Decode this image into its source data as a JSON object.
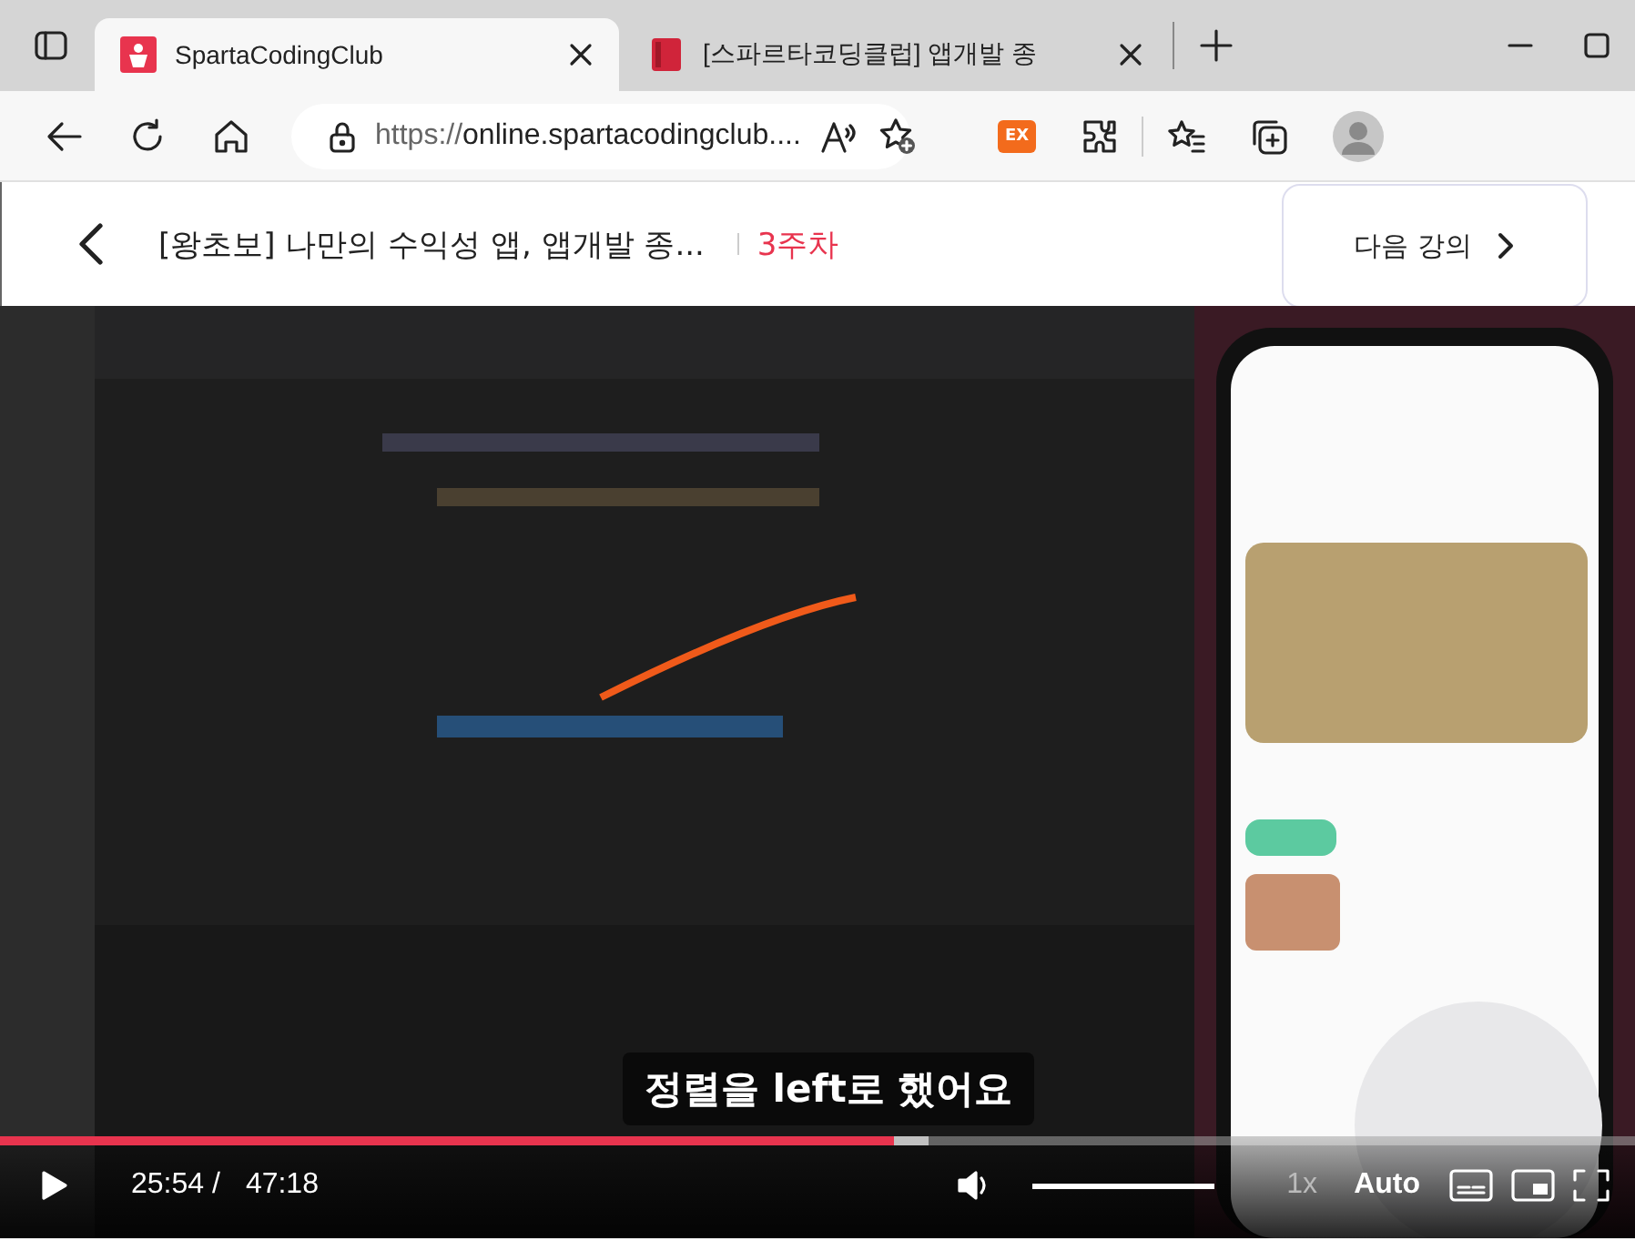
{
  "browser": {
    "tabs": [
      {
        "title": "SpartaCodingClub",
        "selected": true
      },
      {
        "title": "[스파르타코딩클럽] 앱개발 종",
        "selected": false
      }
    ],
    "url": {
      "prefix": "https://",
      "host": "online.spartacodingclub...."
    },
    "extension_badge": "EX"
  },
  "lecture_header": {
    "title": "[왕초보] 나만의 수익성 앱, 앱개발 종...",
    "week": "3주차",
    "next_button": "다음 강의"
  },
  "video": {
    "kind": "picture",
    "caption": "정렬을 left로 했어요",
    "progress": {
      "level": 0.547
    },
    "buffered": {
      "level": 0.568
    },
    "current_time": "25:54 /",
    "duration": "47:18",
    "volume": {
      "level": 1
    },
    "speed": "1x",
    "quality": "Auto"
  }
}
